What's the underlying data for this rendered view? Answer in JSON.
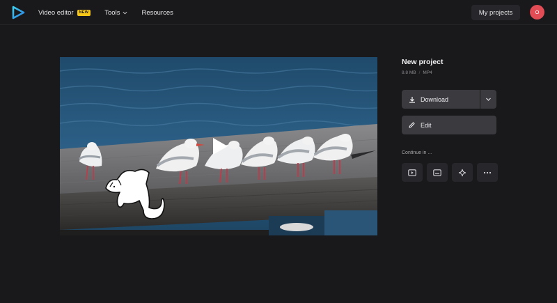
{
  "header": {
    "logo_icon": "play-triangle-logo",
    "nav": {
      "video_editor": "Video editor",
      "video_editor_badge": "NEW",
      "tools": "Tools",
      "resources": "Resources"
    },
    "my_projects": "My projects",
    "avatar_initial": "O"
  },
  "video": {
    "play_icon": "play-icon",
    "sticker": "cat-sticker"
  },
  "project": {
    "title": "New project",
    "size": "8.8 MB",
    "separator": "/",
    "format": "MP4"
  },
  "actions": {
    "download_label": "Download",
    "edit_label": "Edit"
  },
  "continue": {
    "label": "Continue in ...",
    "buttons": [
      "video-player-icon",
      "subtitles-icon",
      "sparkle-icon",
      "more-icon"
    ]
  },
  "colors": {
    "background": "#19191b",
    "button": "#3a3a3f",
    "button_dark": "#27272b",
    "avatar": "#e24c55",
    "badge": "#f5c518"
  }
}
